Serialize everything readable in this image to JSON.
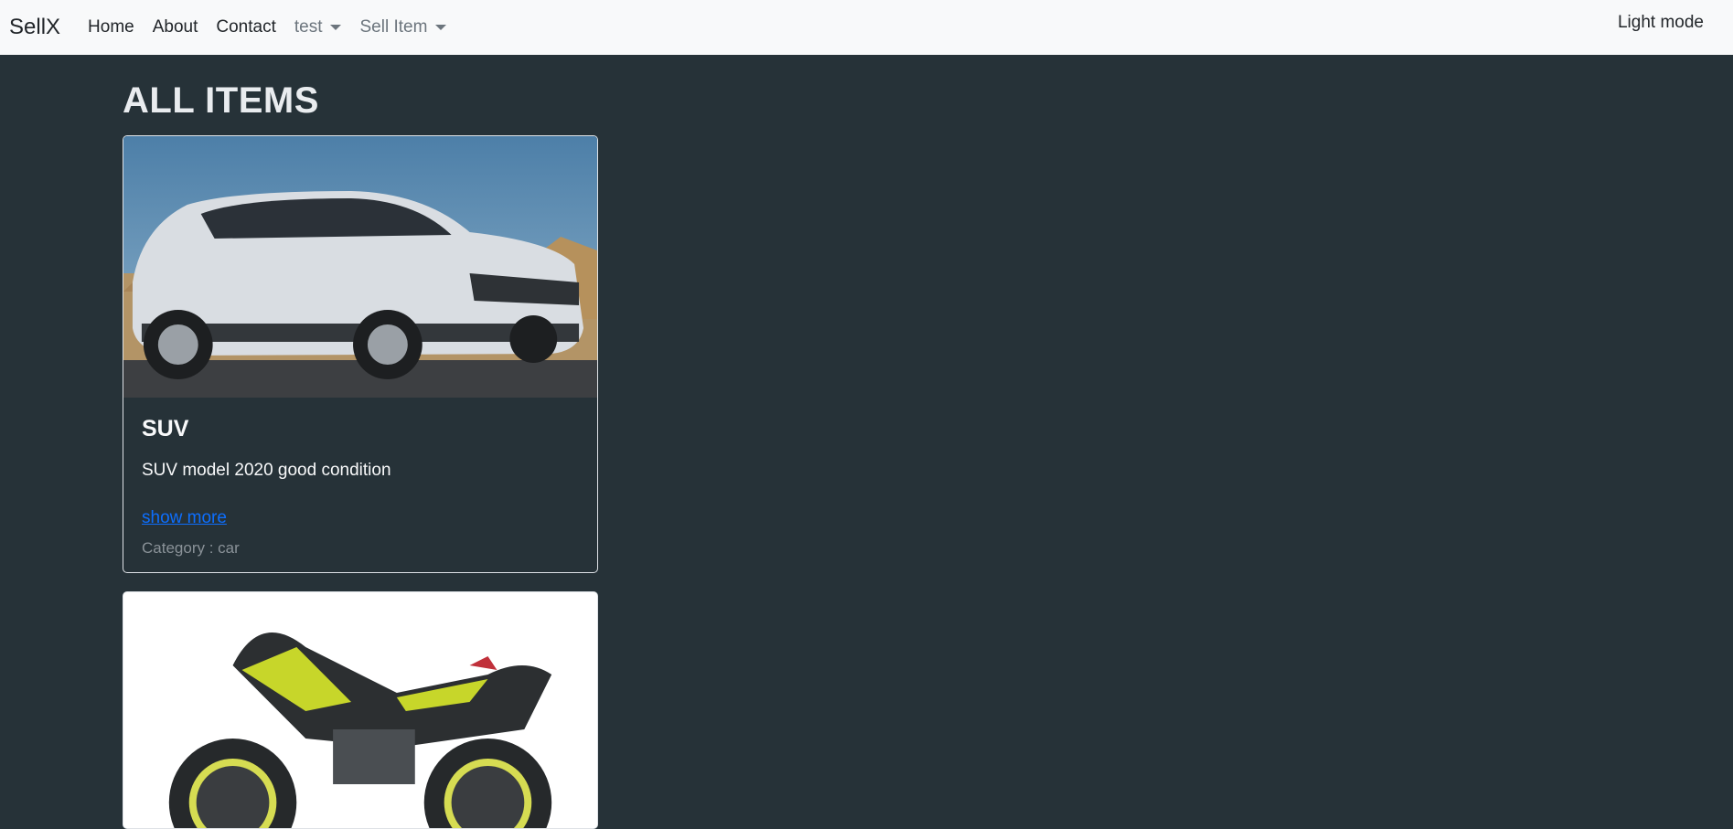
{
  "navbar": {
    "brand": "SellX",
    "links": [
      "Home",
      "About",
      "Contact"
    ],
    "dropdowns": [
      "test",
      "Sell Item"
    ],
    "mode_toggle": "Light mode"
  },
  "page_title": "ALL ITEMS",
  "items": [
    {
      "title": "SUV",
      "description": "SUV model 2020 good condition",
      "link": "show more",
      "category": "Category : car",
      "image": "white-suv-photo"
    },
    {
      "image": "sport-motorcycle-photo"
    }
  ],
  "colors": {
    "background": "#263238",
    "navbar": "#f8f9fa",
    "link": "#0d6efd"
  }
}
